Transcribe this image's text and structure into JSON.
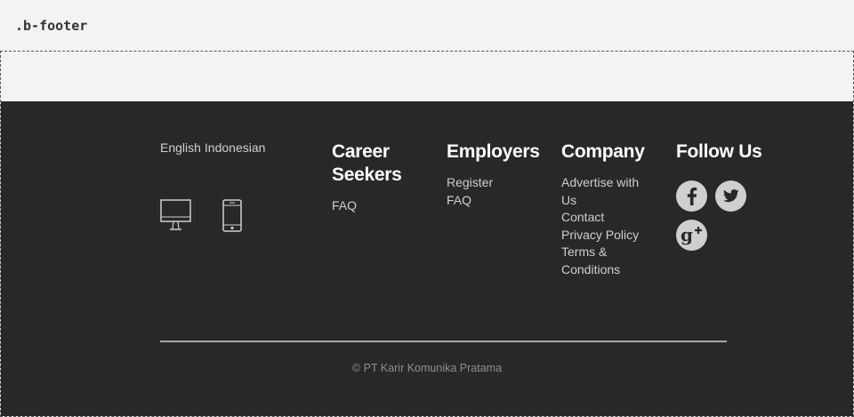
{
  "label": ".b-footer",
  "languages": [
    "English",
    "Indonesian"
  ],
  "device_icons": [
    "desktop-icon",
    "mobile-icon"
  ],
  "columns": [
    {
      "title": "Career Seekers",
      "links": [
        "FAQ"
      ]
    },
    {
      "title": "Employers",
      "links": [
        "Register",
        "FAQ"
      ]
    },
    {
      "title": "Company",
      "links": [
        "Advertise with Us",
        "Contact",
        "Privacy Policy",
        "Terms & Conditions"
      ]
    },
    {
      "title": "Follow Us",
      "links": []
    }
  ],
  "social": [
    "facebook-icon",
    "twitter-icon",
    "google-plus-icon"
  ],
  "copyright": "© PT Karir Komunika Pratama",
  "colors": {
    "footer_bg": "#282828",
    "page_bg": "#f3f3f3",
    "heading": "#ffffff",
    "link": "#cfcfcf",
    "icon_fill": "#cfcfcf",
    "divider": "#a6a6a6",
    "copyright": "#8f8f8f"
  }
}
